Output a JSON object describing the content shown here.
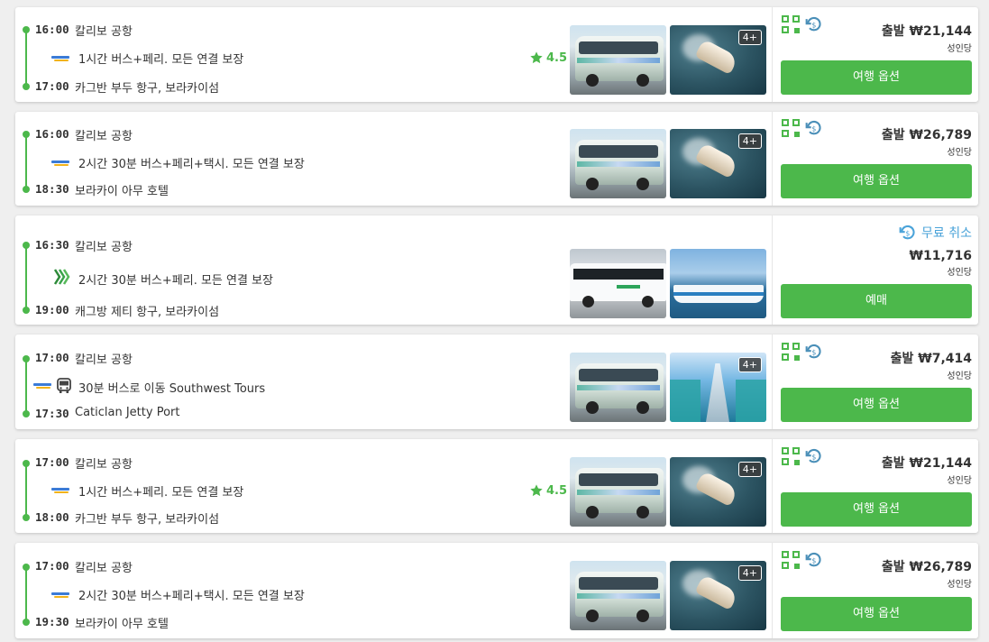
{
  "rows": [
    {
      "dep_time": "16:00",
      "dep_place": "칼리보 공항",
      "description": "1시간 버스+페리. 모든 연결 보장",
      "arr_time": "17:00",
      "arr_place": "카그반 부두 항구, 보라카이섬",
      "rating": "4.5",
      "photo_badge": "4+",
      "price_label": "출발 ₩21,144",
      "price_per": "성인당",
      "button": "여행 옵션"
    },
    {
      "dep_time": "16:00",
      "dep_place": "칼리보 공항",
      "description": "2시간 30분 버스+페리+택시. 모든 연결 보장",
      "arr_time": "18:30",
      "arr_place": "보라카이 아무 호텔",
      "photo_badge": "4+",
      "price_label": "출발 ₩26,789",
      "price_per": "성인당",
      "button": "여행 옵션"
    },
    {
      "dep_time": "16:30",
      "dep_place": "칼리보 공항",
      "description": "2시간 30분 버스+페리. 모든 연결 보장",
      "arr_time": "19:00",
      "arr_place": "캐그방 제티 항구, 보라카이섬",
      "free_cancel": "무료 취소",
      "price_label": "₩11,716",
      "price_per": "성인당",
      "button": "예매"
    },
    {
      "dep_time": "17:00",
      "dep_place": "칼리보 공항",
      "description": "30분 버스로 이동 Southwest Tours",
      "arr_time": "17:30",
      "arr_place": "Caticlan Jetty Port",
      "photo_badge": "4+",
      "price_label": "출발 ₩7,414",
      "price_per": "성인당",
      "button": "여행 옵션"
    },
    {
      "dep_time": "17:00",
      "dep_place": "칼리보 공항",
      "description": "1시간 버스+페리. 모든 연결 보장",
      "arr_time": "18:00",
      "arr_place": "카그반 부두 항구, 보라카이섬",
      "rating": "4.5",
      "photo_badge": "4+",
      "price_label": "출발 ₩21,144",
      "price_per": "성인당",
      "button": "여행 옵션"
    },
    {
      "dep_time": "17:00",
      "dep_place": "칼리보 공항",
      "description": "2시간 30분 버스+페리+택시. 모든 연결 보장",
      "arr_time": "19:30",
      "arr_place": "보라카이 아무 호텔",
      "photo_badge": "4+",
      "price_label": "출발 ₩26,789",
      "price_per": "성인당",
      "button": "여행 옵션"
    }
  ],
  "colors": {
    "accent": "#4cb84b",
    "refund": "#4aa3d9"
  },
  "icons": [
    "qr-code-icon",
    "refund-icon",
    "star-icon",
    "bus-icon",
    "operator-logo-icon"
  ]
}
